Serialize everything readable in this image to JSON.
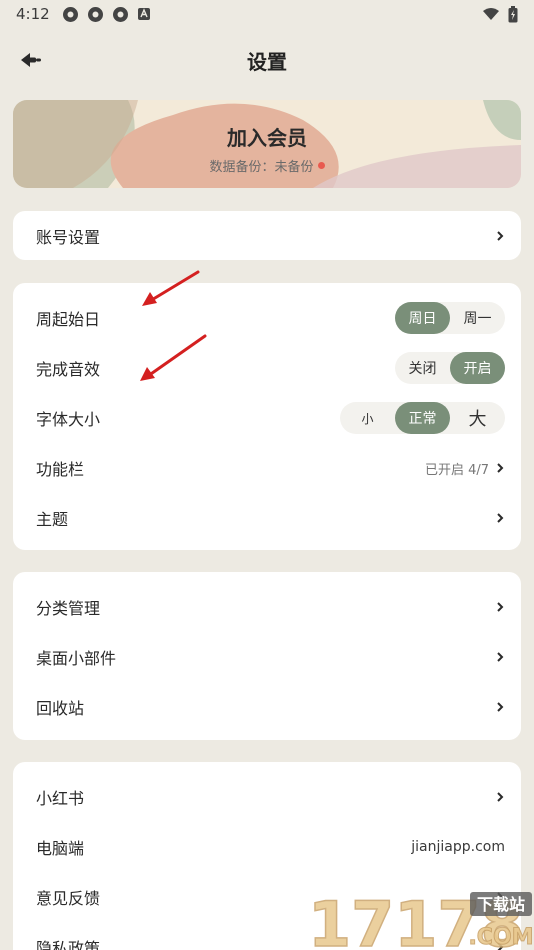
{
  "status": {
    "time": "4:12"
  },
  "header": {
    "title": "设置"
  },
  "banner": {
    "title": "加入会员",
    "subtitle": "数据备份：未备份"
  },
  "account": {
    "label": "账号设置"
  },
  "prefs": {
    "week_start": {
      "label": "周起始日",
      "options": [
        "周日",
        "周一"
      ],
      "selected": "周日"
    },
    "sound": {
      "label": "完成音效",
      "options": [
        "关闭",
        "开启"
      ],
      "selected": "开启"
    },
    "font_size": {
      "label": "字体大小",
      "options": [
        "小",
        "正常",
        "大"
      ],
      "selected": "正常"
    },
    "toolbar": {
      "label": "功能栏",
      "value": "已开启 4/7"
    },
    "theme": {
      "label": "主题"
    }
  },
  "manage": {
    "category": "分类管理",
    "widget": "桌面小部件",
    "trash": "回收站"
  },
  "more": {
    "xiaohongshu": "小红书",
    "desktop": {
      "label": "电脑端",
      "value": "jianjiapp.com"
    },
    "feedback": "意见反馈",
    "privacy": "隐私政策"
  },
  "watermark": {
    "number": "17178",
    "site": "下载站",
    "domain": ".COM"
  },
  "colors": {
    "accent": "#7a8f79",
    "background": "#edeae2",
    "dot": "#e85a4f",
    "arrow": "#d42020"
  }
}
